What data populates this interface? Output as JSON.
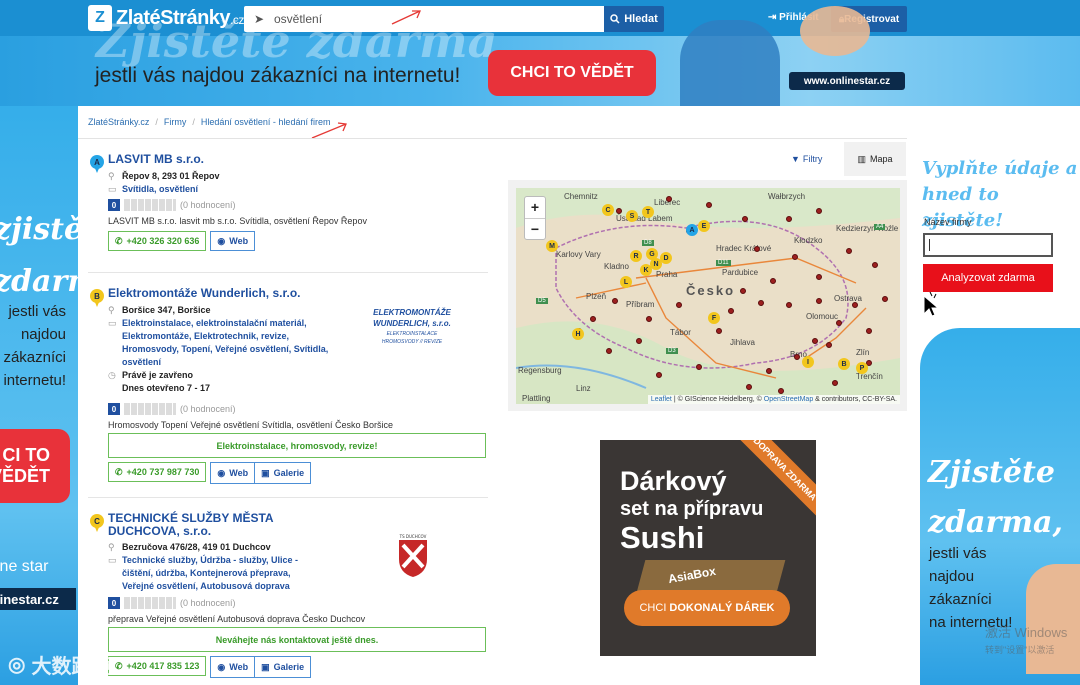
{
  "header": {
    "logo_mark": "Z",
    "logo_text": "ZlatéStránky",
    "logo_tld": ".cz",
    "search_value": "osvětlení",
    "search_button": "Hledat",
    "login": "Přihlásit",
    "register": "Registrovat"
  },
  "top_banner": {
    "ghost_text": "Zjistěte zdarma,",
    "text": "jestli vás najdou zákazníci na internetu!",
    "cta": "CHCI TO VĚDĚT",
    "url": "www.onlinestar.cz"
  },
  "left_ad": {
    "script_line1": "zjistěte",
    "script_line2": "zdarma,",
    "text_lines": [
      "jestli vás",
      "najdou",
      "zákazníci",
      "internetu!"
    ],
    "cta_line1": "CI TO",
    "cta_line2": "VĚDĚT",
    "brand": "ine star",
    "url": "linestar.cz"
  },
  "breadcrumb": [
    "ZlatéStránky.cz",
    "Firmy",
    "Hledání osvětlení - hledání firem"
  ],
  "listings": [
    {
      "marker": "A",
      "name": "LASVIT MB s.r.o.",
      "address": "Řepov 8, 293 01 Řepov",
      "categories": "Svítidla, osvětlení",
      "rating_value": "0",
      "rating_text": "(0 hodnocení)",
      "description": "LASVIT MB s.r.o. lasvit mb s.r.o. Svítidla, osvětlení Řepov Řepov",
      "phone": "+420 326 320 636",
      "web": "Web"
    },
    {
      "marker": "B",
      "name": "Elektromontáže Wunderlich, s.r.o.",
      "address": "Boršice 347, Boršice",
      "categories": "Elektroinstalace, elektroinstalační materiál, Elektromontáže, Elektrotechnik, revize, Hromosvody, Topení, Veřejné osvětlení, Svítidla, osvětlení",
      "status": "Právě je zavřeno",
      "hours": "Dnes otevřeno 7 - 17",
      "logo_title": "ELEKTROMONTÁŽE WUNDERLICH, s.r.o.",
      "logo_sub1": "ELEKTROINSTALACE",
      "logo_sub2": "HROMOSVODY // REVIZE",
      "rating_value": "0",
      "rating_text": "(0 hodnocení)",
      "description": "Hromosvody Topení Veřejné osvětlení Svítidla, osvětlení Česko Boršice",
      "highlight": "Elektroinstalace, hromosvody, revize!",
      "phone": "+420 737 987 730",
      "web": "Web",
      "gallery": "Galerie"
    },
    {
      "marker": "C",
      "name": "TECHNICKÉ SLUŽBY MĚSTA DUCHCOVA, s.r.o.",
      "address": "Bezručova 476/28, 419 01 Duchcov",
      "categories": "Technické služby, Údržba - služby, Ulice - čištění, údržba, Kontejnerová přeprava, Veřejné osvětlení, Autobusová doprava",
      "logo_text": "TS DUCHCOV",
      "rating_value": "0",
      "rating_text": "(0 hodnocení)",
      "description": "přeprava Veřejné osvětlení Autobusová doprava Česko Duchcov",
      "highlight": "Neváhejte nás kontaktovat ještě dnes.",
      "phone": "+420 417 835 123",
      "web": "Web",
      "gallery": "Galerie"
    }
  ],
  "map_panel": {
    "filters": "Filtry",
    "map_tab": "Mapa",
    "zoom_in": "+",
    "zoom_out": "−",
    "country": "Česko",
    "cities": [
      "Chemnitz",
      "Liberec",
      "Wałbrzych",
      "Ústí nad Labem",
      "Kłodzko",
      "Kedzierzyn-Koźle",
      "Hradec Králové",
      "Karlovy Vary",
      "Kladno",
      "Praha",
      "Pardubice",
      "Ostrava",
      "Plzeň",
      "Příbram",
      "Olomouc",
      "Jihlava",
      "Tábor",
      "Brno",
      "Zlín",
      "Regensburg",
      "Trenčín",
      "Plattling",
      "Linz"
    ],
    "roads": [
      "D8",
      "D11",
      "D5",
      "D3",
      "A4"
    ],
    "attribution_leaflet": "Leaflet",
    "attribution_text": "| © GIScience Heidelberg, ©",
    "attribution_osm": "OpenStreetMap",
    "attribution_end": "& contributors, CC-BY-SA."
  },
  "sushi_ad": {
    "diagonal": "DOPRAVA ZDARMA",
    "line1": "Dárkový",
    "line2": "set na přípravu",
    "line3": "Sushi",
    "box_label": "AsiaBox",
    "cta_plain": "CHCI",
    "cta_bold": "DOKONALÝ DÁREK"
  },
  "right_ad": {
    "script_line1": "Vyplňte údaje a",
    "script_line2": "hned to zjistěte!",
    "field_label": "Název firmy",
    "button": "Analyzovat zdarma",
    "bottom_script1": "Zjistěte",
    "bottom_script2": "zdarma,",
    "bottom_text": [
      "jestli vás",
      "najdou",
      "zákazníci",
      "na internetu!"
    ]
  },
  "watermark": {
    "text": "大数跨境",
    "win_line1": "激活 Windows",
    "win_line2": "转到\"设置\"以激活"
  }
}
